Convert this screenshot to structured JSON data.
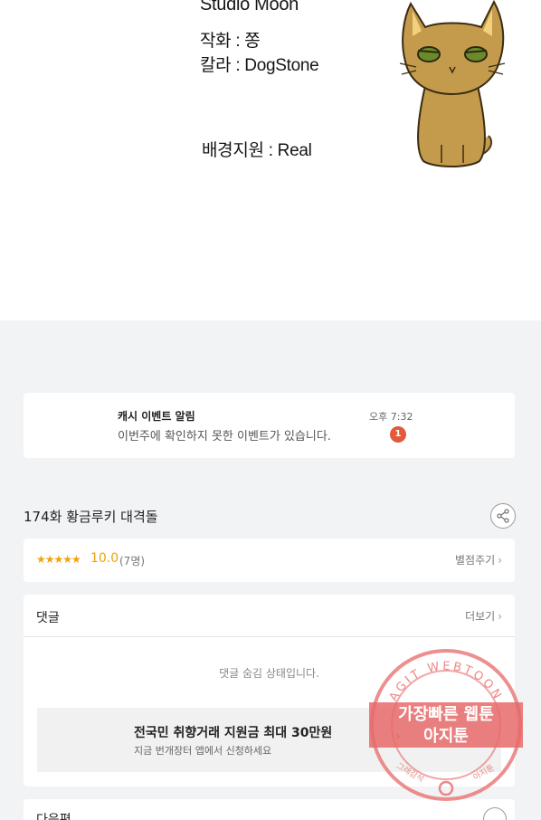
{
  "credits": {
    "studio": "Studio Moon",
    "artist": "작화 : 쫑",
    "color": "칼라 : DogStone",
    "background": "배경지원 : Real"
  },
  "notification": {
    "title": "캐시 이벤트 알림",
    "message": "이번주에 확인하지 못한 이벤트가 있습니다.",
    "time": "오후 7:32",
    "badge": "1"
  },
  "episode": {
    "title": "174화 황금루키 대격돌",
    "share_icon": "share-icon"
  },
  "rating": {
    "stars": "★★★★★",
    "score": "10.0",
    "votes": "(7명)",
    "rate_label": "별점주기"
  },
  "comments": {
    "title": "댓글",
    "more_label": "더보기",
    "hidden_message": "댓글 숨김 상태입니다."
  },
  "ad": {
    "title": "전국민 취향거래 지원금 최대 30만원",
    "subtitle": "지금 번개장터 앱에서 신청하세요",
    "arrow": "›"
  },
  "next": {
    "title": "다음편"
  },
  "watermark": {
    "arc_text": "AGIT WEBTOON",
    "line1": "가장빠른 웹툰",
    "line2": "아지툰",
    "footer_left": "그래감석",
    "footer_right": "아지툰",
    "color": "#e86a6a"
  },
  "colors": {
    "accent_star": "#f2a20c",
    "badge": "#e2593b",
    "page_bg": "#f2f3f4"
  }
}
